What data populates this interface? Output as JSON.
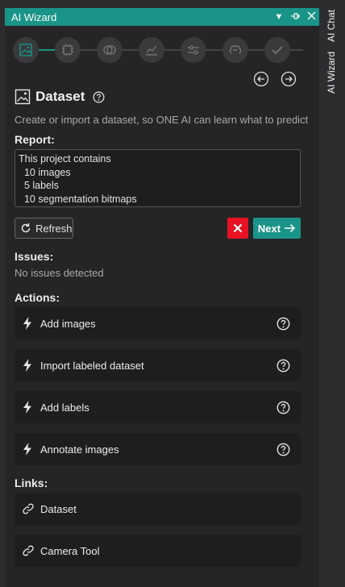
{
  "window": {
    "title": "AI Wizard"
  },
  "side_tabs": [
    "AI Chat",
    "AI Wizard"
  ],
  "steps": [
    "image-icon",
    "chip-icon",
    "layers-icon",
    "chart-icon",
    "sliders-icon",
    "brain-icon",
    "check-icon"
  ],
  "header": {
    "title": "Dataset",
    "description": "Create or import a dataset, so ONE AI can learn what to predict"
  },
  "report": {
    "label": "Report:",
    "lines": [
      "This project contains",
      "  10 images",
      "  5 labels",
      "  10 segmentation bitmaps"
    ]
  },
  "buttons": {
    "refresh": "Refresh",
    "next": "Next"
  },
  "issues": {
    "label": "Issues:",
    "text": "No issues detected"
  },
  "actions": {
    "label": "Actions:",
    "items": [
      "Add images",
      "Import labeled dataset",
      "Add labels",
      "Annotate images"
    ]
  },
  "links": {
    "label": "Links:",
    "items": [
      "Dataset",
      "Camera Tool"
    ]
  },
  "colors": {
    "accent": "#1a9488",
    "cancel": "#e81123",
    "panel": "#252526",
    "card": "#1e1e1e"
  }
}
